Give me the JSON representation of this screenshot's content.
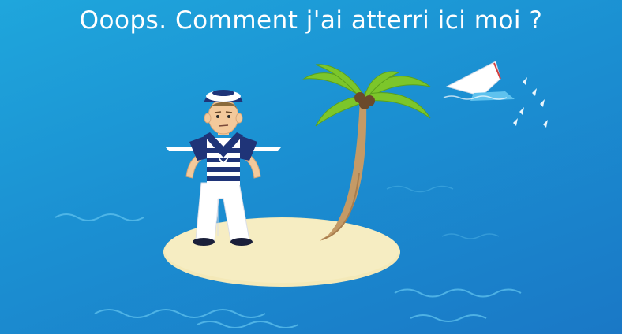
{
  "headline": "Ooops. Comment j'ai atterri ici moi ?",
  "colors": {
    "ocean": "#1b90d2",
    "sand": "#f4e9b8",
    "palm_leaves": "#7cc62a",
    "trunk": "#c49a66",
    "sailor_navy": "#1f3478",
    "text": "#ffffff"
  },
  "icons": [
    "sailor-character",
    "palm-tree",
    "sand-island",
    "sinking-boat",
    "ocean-waves"
  ]
}
